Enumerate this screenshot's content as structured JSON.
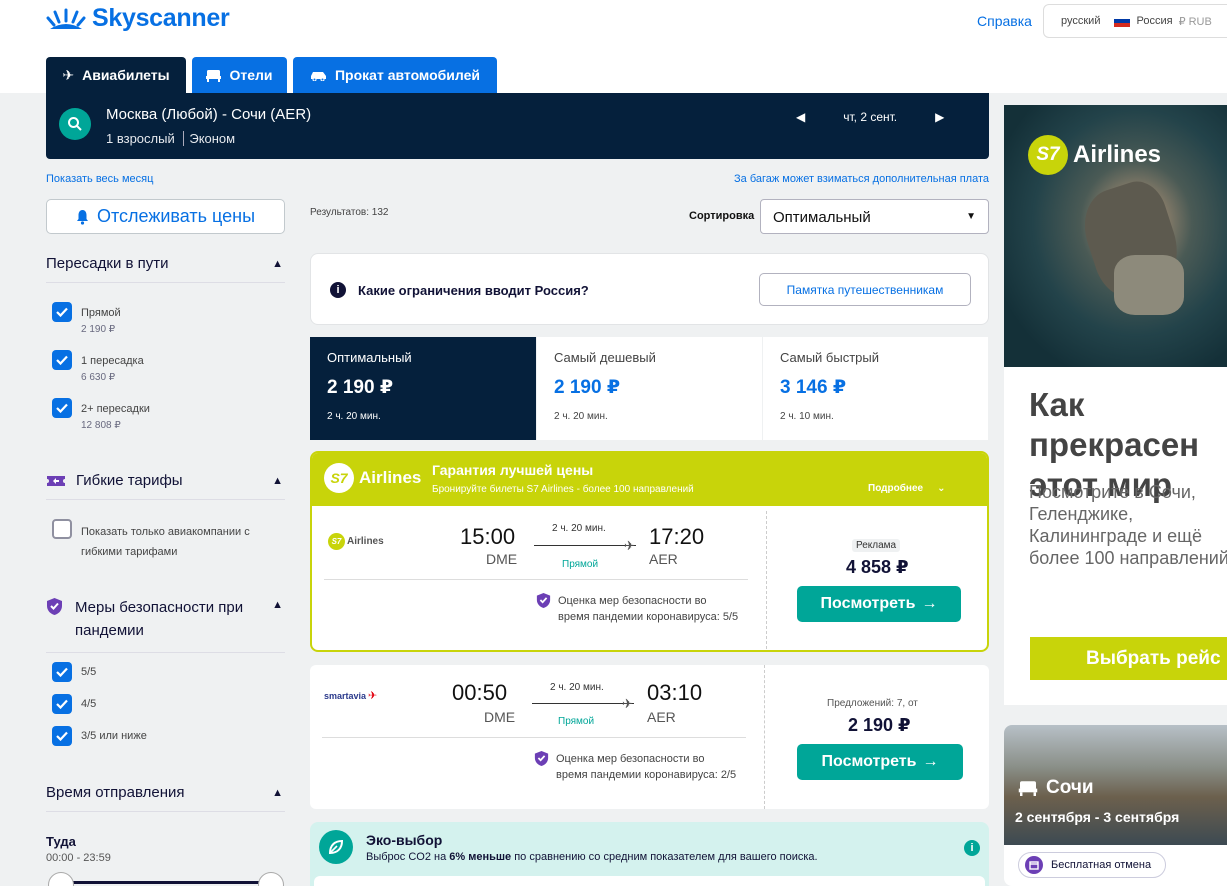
{
  "header": {
    "brand": "Skyscanner",
    "help": "Справка",
    "language": "русский",
    "country": "Россия",
    "currency": "₽ RUB"
  },
  "tabs": [
    {
      "label": "Авиабилеты"
    },
    {
      "label": "Отели"
    },
    {
      "label": "Прокат автомобилей"
    }
  ],
  "search": {
    "route": "Москва (Любой) - Сочи (AER)",
    "passengers": "1 взрослый",
    "cabin": "Эконом",
    "date": "чт, 2 сент."
  },
  "links": {
    "whole_month": "Показать весь месяц",
    "baggage": "За багаж может взиматься дополнительная плата"
  },
  "track_prices": "Отслеживать цены",
  "filters": {
    "stops": {
      "title": "Пересадки в пути",
      "items": [
        {
          "label": "Прямой",
          "price": "2 190 ₽"
        },
        {
          "label": "1 пересадка",
          "price": "6 630 ₽"
        },
        {
          "label": "2+ пересадки",
          "price": "12 808 ₽"
        }
      ]
    },
    "flex": {
      "title": "Гибкие тарифы",
      "item": "Показать только авиакомпании с гибкими тарифами"
    },
    "safety": {
      "title": "Меры безопасности при пандемии",
      "items": [
        "5/5",
        "4/5",
        "3/5 или ниже"
      ]
    },
    "departure": {
      "title": "Время отправления",
      "sub": "Туда",
      "range": "00:00 - 23:59"
    }
  },
  "results": {
    "count_label": "Результатов: 132",
    "sort_label": "Сортировка",
    "sort_value": "Оптимальный"
  },
  "notice": {
    "text": "Какие ограничения вводит Россия?",
    "button": "Памятка путешественникам"
  },
  "sort_tabs": [
    {
      "label": "Оптимальный",
      "price": "2 190 ₽",
      "duration": "2 ч. 20 мин."
    },
    {
      "label": "Самый дешевый",
      "price": "2 190 ₽",
      "duration": "2 ч. 20 мин."
    },
    {
      "label": "Самый быстрый",
      "price": "3 146 ₽",
      "duration": "2 ч. 10 мин."
    }
  ],
  "s7promo": {
    "logo": "Airlines",
    "logo_mark": "S7",
    "title": "Гарантия лучшей цены",
    "subtitle": "Бронируйте билеты S7 Airlines - более 100 направлений",
    "more": "Подробнее"
  },
  "flights": [
    {
      "airline": "Airlines",
      "airline_mark": "S7",
      "dep_time": "15:00",
      "dep_airport": "DME",
      "arr_time": "17:20",
      "arr_airport": "AER",
      "duration": "2 ч. 20 мин.",
      "stops": "Прямой",
      "safety": "Оценка мер безопасности во время пандемии коронавируса: 5/5",
      "badge": "Реклама",
      "price": "4 858 ₽",
      "button": "Посмотреть"
    },
    {
      "airline": "smartavia",
      "dep_time": "00:50",
      "dep_airport": "DME",
      "arr_time": "03:10",
      "arr_airport": "AER",
      "duration": "2 ч. 20 мин.",
      "stops": "Прямой",
      "safety": "Оценка мер безопасности во время пандемии коронавируса: 2/5",
      "offers": "Предложений: 7, от",
      "price": "2 190 ₽",
      "button": "Посмотреть"
    }
  ],
  "eco": {
    "title": "Эко-выбор",
    "text_before": "Выброс CO2 на ",
    "text_bold": "6% меньше",
    "text_after": " по сравнению со средним показателем для вашего поиска."
  },
  "ad": {
    "brand": "Airlines",
    "brand_mark": "S7",
    "headline": "Как прекрасен этот мир",
    "body": "Посмотрите в Сочи, Геленджике, Калининграде и ещё более 100 направлений",
    "cta": "Выбрать рейс"
  },
  "hotel": {
    "city": "Сочи",
    "dates": "2 сентября - 3 сентября",
    "badge": "Бесплатная отмена"
  },
  "colors": {
    "brand_blue": "#0770e3",
    "navy": "#05203c",
    "teal": "#00a698",
    "s7_green": "#c8d40a"
  }
}
